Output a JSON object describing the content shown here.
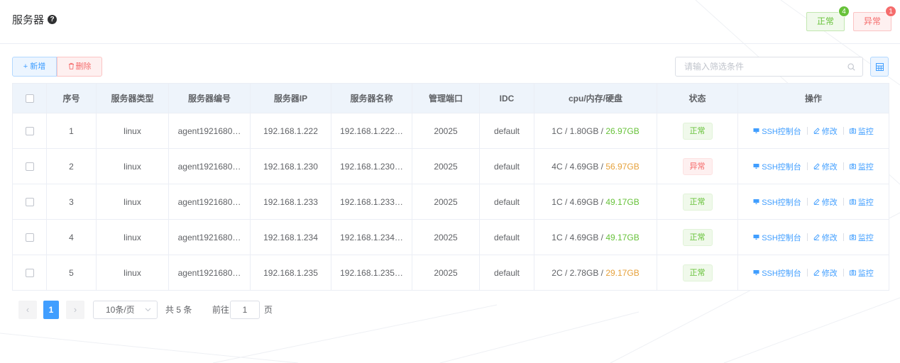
{
  "header": {
    "title": "服务器",
    "help_glyph": "?",
    "status_ok": {
      "label": "正常",
      "count": "4"
    },
    "status_err": {
      "label": "异常",
      "count": "1"
    }
  },
  "toolbar": {
    "add_label": "+ 新增",
    "delete_label": "删除",
    "search_placeholder": "请输入筛选条件"
  },
  "colors": {
    "primary": "#409eff",
    "success": "#67c23a",
    "warning": "#e6a23c",
    "danger": "#f56c6c"
  },
  "table": {
    "columns": [
      "序号",
      "服务器类型",
      "服务器编号",
      "服务器IP",
      "服务器名称",
      "管理端口",
      "IDC",
      "cpu/内存/硬盘",
      "状态",
      "操作"
    ],
    "rows": [
      {
        "index": "1",
        "type": "linux",
        "id": "agent1921680…",
        "ip": "192.168.1.222",
        "name": "192.168.1.222…",
        "port": "20025",
        "idc": "default",
        "cpu_mem": "1C / 1.80GB / ",
        "disk": "26.97GB",
        "disk_level": "ok",
        "status": "正常",
        "status_level": "ok"
      },
      {
        "index": "2",
        "type": "linux",
        "id": "agent1921680…",
        "ip": "192.168.1.230",
        "name": "192.168.1.230…",
        "port": "20025",
        "idc": "default",
        "cpu_mem": "4C / 4.69GB / ",
        "disk": "56.97GB",
        "disk_level": "warn",
        "status": "异常",
        "status_level": "err"
      },
      {
        "index": "3",
        "type": "linux",
        "id": "agent1921680…",
        "ip": "192.168.1.233",
        "name": "192.168.1.233…",
        "port": "20025",
        "idc": "default",
        "cpu_mem": "1C / 4.69GB / ",
        "disk": "49.17GB",
        "disk_level": "ok",
        "status": "正常",
        "status_level": "ok"
      },
      {
        "index": "4",
        "type": "linux",
        "id": "agent1921680…",
        "ip": "192.168.1.234",
        "name": "192.168.1.234…",
        "port": "20025",
        "idc": "default",
        "cpu_mem": "1C / 4.69GB / ",
        "disk": "49.17GB",
        "disk_level": "ok",
        "status": "正常",
        "status_level": "ok"
      },
      {
        "index": "5",
        "type": "linux",
        "id": "agent1921680…",
        "ip": "192.168.1.235",
        "name": "192.168.1.235…",
        "port": "20025",
        "idc": "default",
        "cpu_mem": "2C / 2.78GB / ",
        "disk": "29.17GB",
        "disk_level": "warn",
        "status": "正常",
        "status_level": "ok"
      }
    ],
    "actions": [
      "SSH控制台",
      "修改",
      "监控"
    ]
  },
  "pagination": {
    "prev_glyph": "‹",
    "next_glyph": "›",
    "current_page": "1",
    "page_size": "10条/页",
    "total": "共 5 条",
    "goto_label": "前往",
    "goto_value": "1",
    "page_unit": "页"
  }
}
